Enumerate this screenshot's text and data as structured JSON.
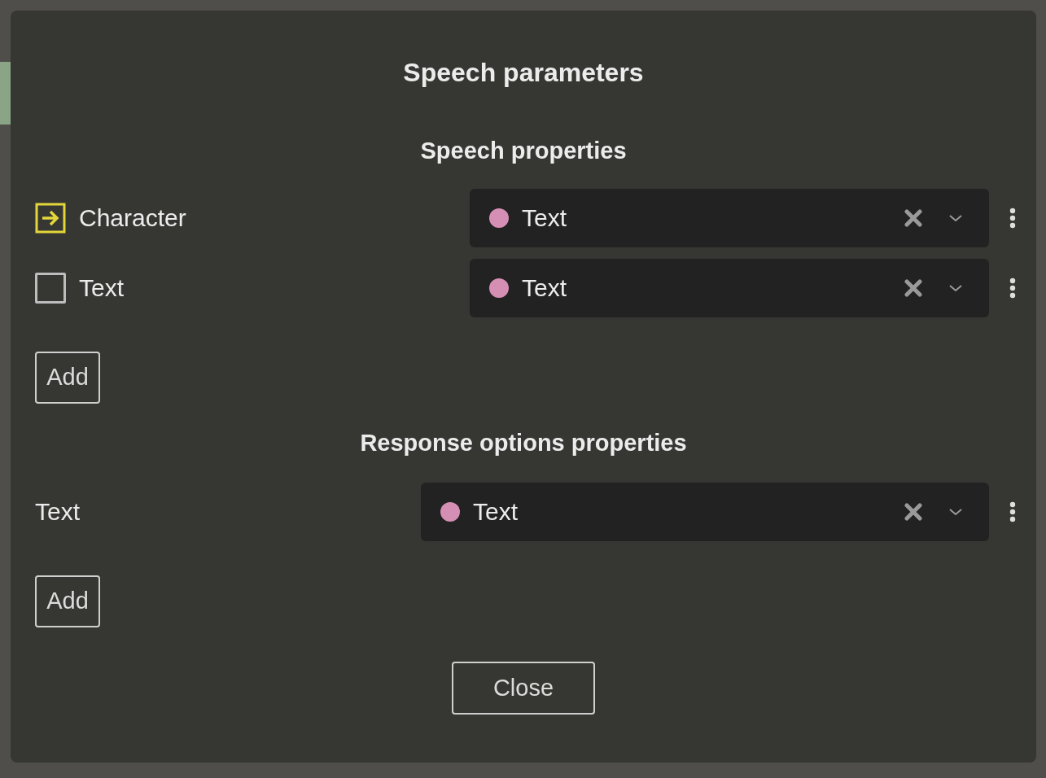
{
  "dialog": {
    "title": "Speech parameters",
    "sections": [
      {
        "heading": "Speech properties",
        "rows": [
          {
            "kind": "linked",
            "label": "Character",
            "value": "Text",
            "color": "#d68fb4"
          },
          {
            "kind": "checkbox",
            "checked": false,
            "label": "Text",
            "value": "Text",
            "color": "#d68fb4"
          }
        ],
        "add_button": "Add"
      },
      {
        "heading": "Response options properties",
        "rows": [
          {
            "kind": "plain",
            "label": "Text",
            "value": "Text",
            "color": "#d68fb4"
          }
        ],
        "add_button": "Add"
      }
    ],
    "close_button": "Close"
  }
}
